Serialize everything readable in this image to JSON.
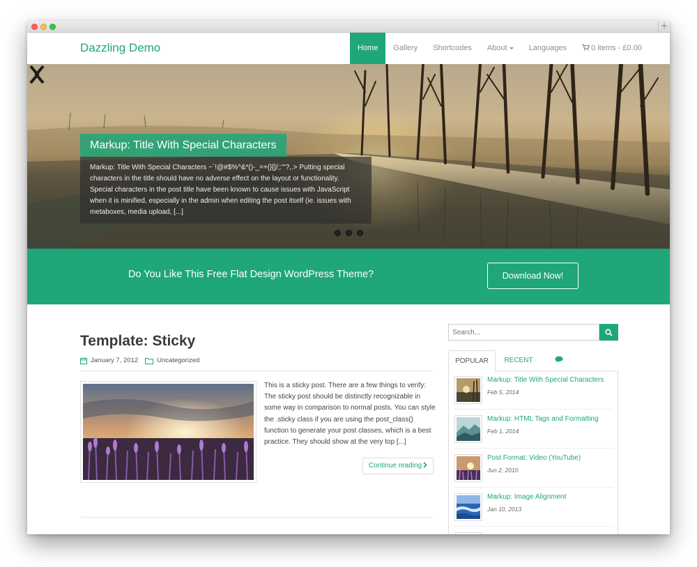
{
  "site": {
    "brand": "Dazzling Demo"
  },
  "nav": {
    "items": [
      "Home",
      "Gallery",
      "Shortcodes",
      "About",
      "Languages"
    ],
    "cart": "0 items - £0.00"
  },
  "hero": {
    "title": "Markup: Title With Special Characters",
    "caption": "Markup: Title With Special Characters ~`!@#$%^&*()-_=+{}[]/;:'\"?,.> Putting special characters in the title should have no adverse effect on the layout or functionality. Special characters in the post title have been known to cause issues with JavaScript when it is minified, especially in the admin when editing the post itself (ie. issues with metaboxes, media upload, [...]"
  },
  "cta": {
    "text": "Do You Like This Free Flat Design WordPress Theme?",
    "button": "Download Now!"
  },
  "post": {
    "title": "Template: Sticky",
    "date": "January 7, 2012",
    "category": "Uncategorized",
    "excerpt": "This is a sticky post. There are a few things to verify: The sticky post should be distinctly recognizable in some way in comparison to normal posts. You can style the .sticky class if you are using the post_class() function to generate your post classes, which is a best practice. They should show at the very top [...]",
    "continue": "Continue reading"
  },
  "sidebar": {
    "search_placeholder": "Search...",
    "tabs": {
      "popular": "POPULAR",
      "recent": "RECENT"
    },
    "items": [
      {
        "title": "Markup: Title With Special Characters",
        "date": "Feb 5, 2014"
      },
      {
        "title": "Markup: HTML Tags and Formatting",
        "date": "Feb 1, 2014"
      },
      {
        "title": "Post Format: Video (YouTube)",
        "date": "Jun 2, 2010"
      },
      {
        "title": "Markup: Image Alignment",
        "date": "Jan 10, 2013"
      }
    ]
  },
  "colors": {
    "accent": "#1fa67a"
  }
}
